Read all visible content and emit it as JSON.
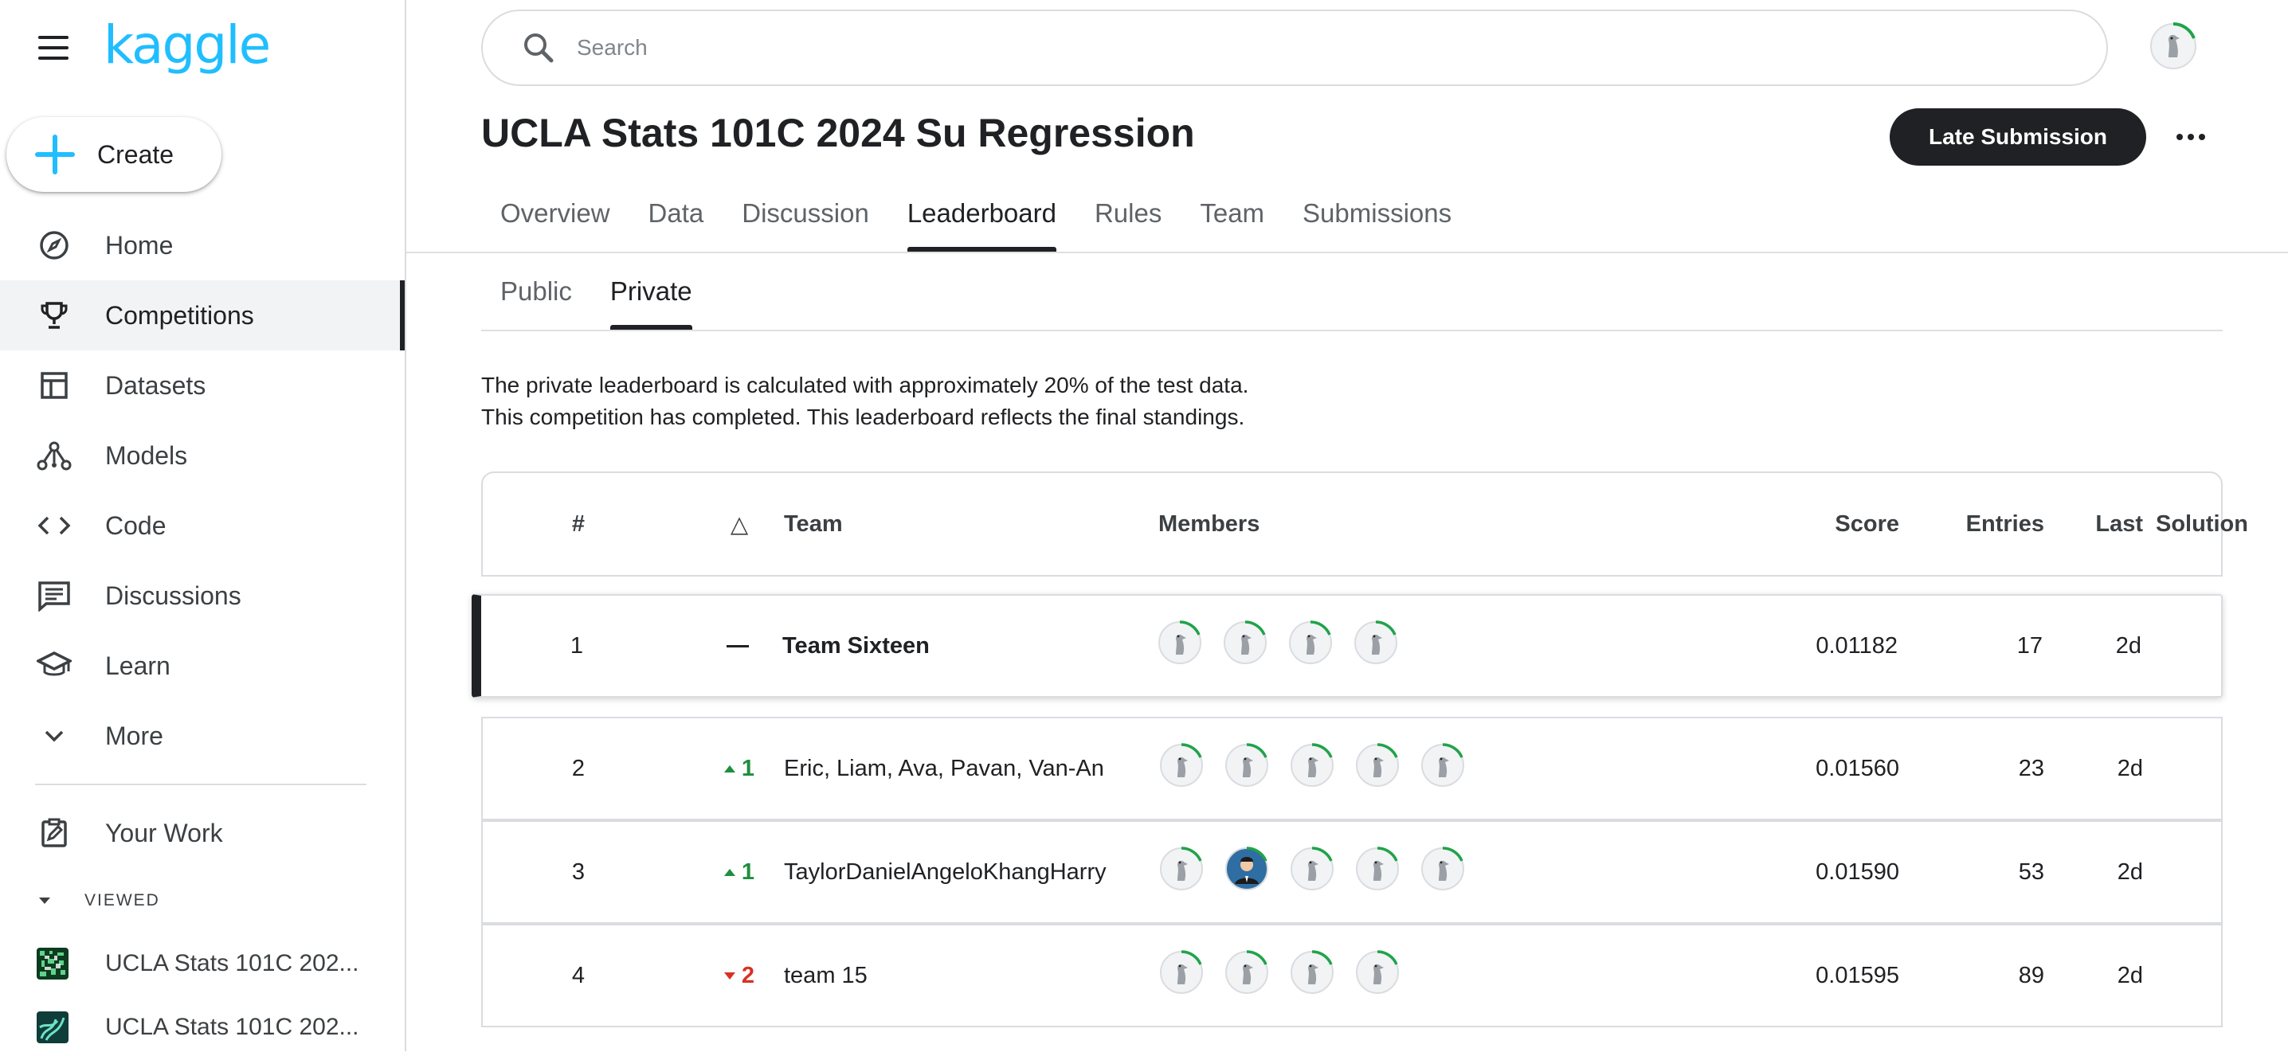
{
  "sidebar": {
    "logo": "kaggle",
    "create_label": "Create",
    "items": [
      {
        "label": "Home",
        "icon": "compass-icon",
        "active": false
      },
      {
        "label": "Competitions",
        "icon": "trophy-icon",
        "active": true
      },
      {
        "label": "Datasets",
        "icon": "table-icon",
        "active": false
      },
      {
        "label": "Models",
        "icon": "models-icon",
        "active": false
      },
      {
        "label": "Code",
        "icon": "code-icon",
        "active": false
      },
      {
        "label": "Discussions",
        "icon": "comments-icon",
        "active": false
      },
      {
        "label": "Learn",
        "icon": "school-icon",
        "active": false
      },
      {
        "label": "More",
        "icon": "chevron-down-icon",
        "active": false
      }
    ],
    "your_work_label": "Your Work",
    "viewed_label": "VIEWED",
    "recent": [
      {
        "label": "UCLA Stats 101C 202..."
      },
      {
        "label": "UCLA Stats 101C 202..."
      }
    ]
  },
  "search": {
    "placeholder": "Search"
  },
  "header": {
    "title": "UCLA Stats 101C 2024 Su Regression",
    "late_submission_label": "Late Submission"
  },
  "tabs": [
    {
      "label": "Overview"
    },
    {
      "label": "Data"
    },
    {
      "label": "Discussion"
    },
    {
      "label": "Leaderboard",
      "active": true
    },
    {
      "label": "Rules"
    },
    {
      "label": "Team"
    },
    {
      "label": "Submissions"
    }
  ],
  "subtabs": [
    {
      "label": "Public"
    },
    {
      "label": "Private",
      "active": true
    }
  ],
  "info": {
    "line1": "The private leaderboard is calculated with approximately 20% of the test data.",
    "line2": "This competition has completed. This leaderboard reflects the final standings."
  },
  "table": {
    "headers": {
      "rank": "#",
      "delta": "△",
      "team": "Team",
      "members": "Members",
      "score": "Score",
      "entries": "Entries",
      "last": "Last",
      "solution": "Solution"
    },
    "rows": [
      {
        "rank": "1",
        "delta": "—",
        "delta_dir": "none",
        "team": "Team Sixteen",
        "members": 4,
        "photo_member_index": -1,
        "score": "0.01182",
        "entries": "17",
        "last": "2d"
      },
      {
        "rank": "2",
        "delta": "1",
        "delta_dir": "up",
        "team": "Eric, Liam, Ava, Pavan, Van-An",
        "members": 5,
        "photo_member_index": -1,
        "score": "0.01560",
        "entries": "23",
        "last": "2d"
      },
      {
        "rank": "3",
        "delta": "1",
        "delta_dir": "up",
        "team": "TaylorDanielAngeloKhangHarry",
        "members": 5,
        "photo_member_index": 1,
        "score": "0.01590",
        "entries": "53",
        "last": "2d"
      },
      {
        "rank": "4",
        "delta": "2",
        "delta_dir": "down",
        "team": "team 15",
        "members": 4,
        "photo_member_index": -1,
        "score": "0.01595",
        "entries": "89",
        "last": "2d"
      }
    ]
  },
  "colors": {
    "brand": "#20beff",
    "primary": "#202124",
    "up": "#1e8e3e",
    "down": "#d93025",
    "avatar_ring": "#20a34a"
  }
}
